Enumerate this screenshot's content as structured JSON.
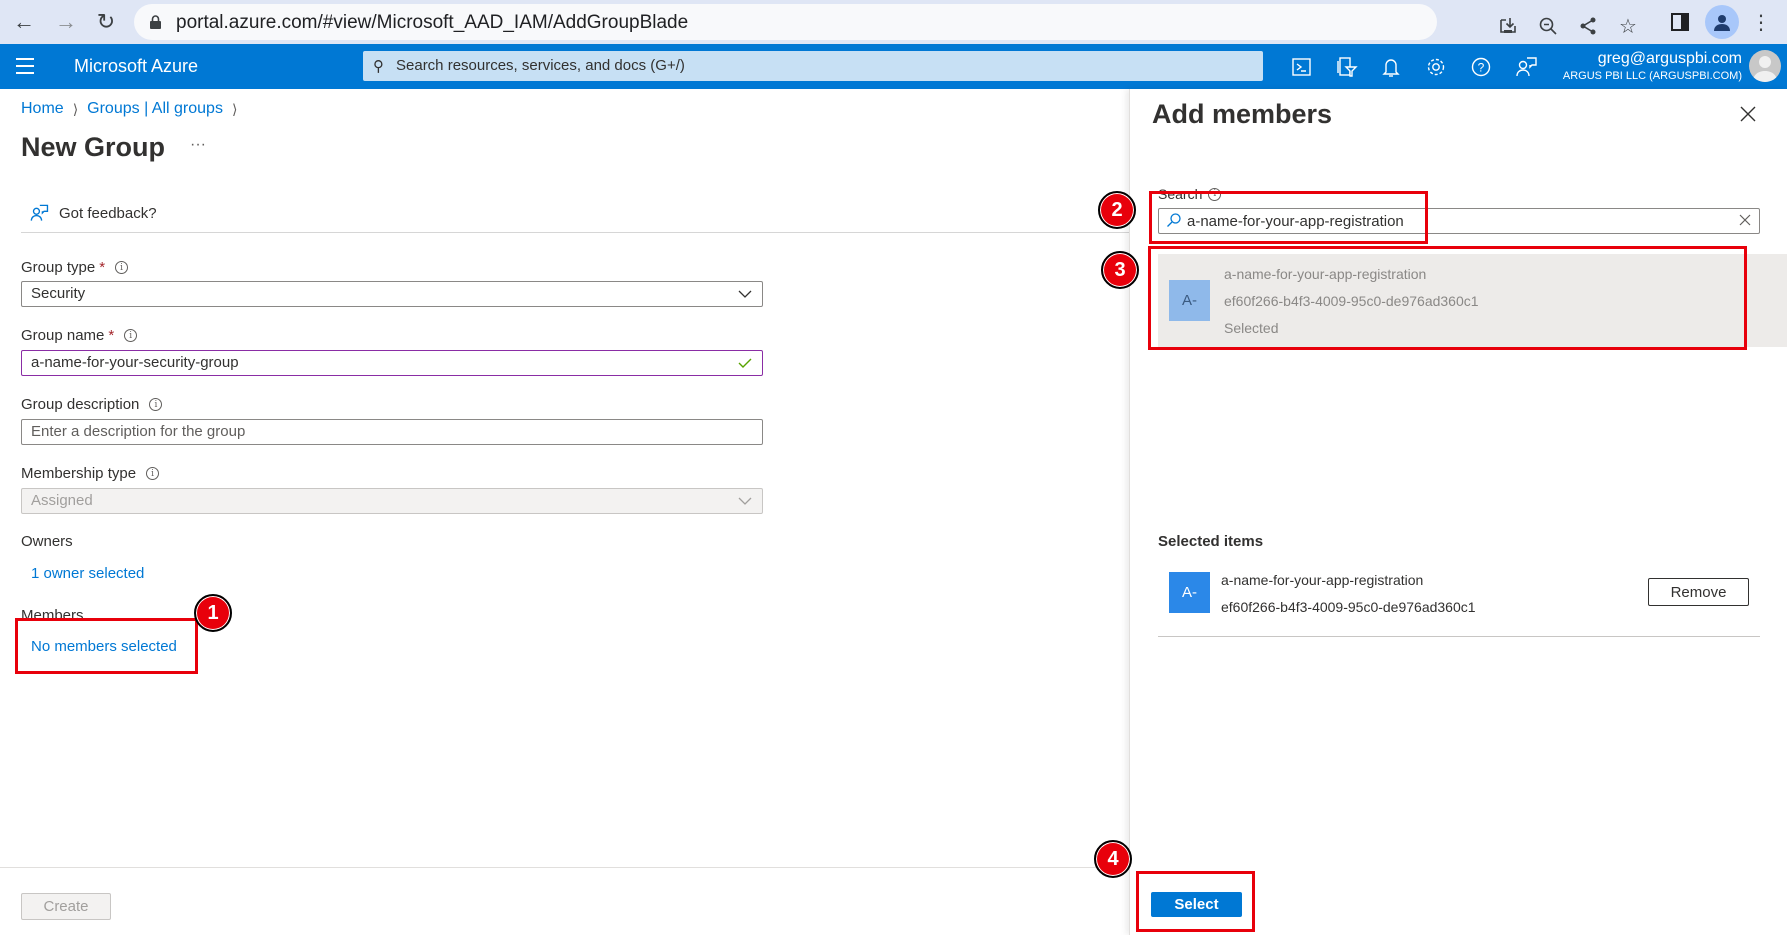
{
  "browser": {
    "url": "portal.azure.com/#view/Microsoft_AAD_IAM/AddGroupBlade",
    "icons": [
      "back-icon",
      "forward-icon",
      "reload-icon",
      "lock-icon",
      "install-icon",
      "zoom-out-icon",
      "share-icon",
      "bookmark-star-icon",
      "side-panel-icon",
      "profile-icon",
      "more-vert-icon"
    ]
  },
  "azure_header": {
    "brand": "Microsoft Azure",
    "search_placeholder": "Search resources, services, and docs (G+/)",
    "icons": [
      "cloud-shell-icon",
      "directory-filter-icon",
      "notifications-icon",
      "settings-icon",
      "help-icon",
      "feedback-icon"
    ],
    "user_email": "greg@arguspbi.com",
    "user_org": "ARGUS PBI LLC (ARGUSPBI.COM)"
  },
  "breadcrumb": [
    {
      "label": "Home"
    },
    {
      "label": "Groups | All groups"
    }
  ],
  "page": {
    "title": "New Group",
    "more_label": "···",
    "feedback_label": "Got feedback?"
  },
  "form": {
    "group_type": {
      "label": "Group type",
      "required": "*",
      "value": "Security"
    },
    "group_name": {
      "label": "Group name",
      "required": "*",
      "value": "a-name-for-your-security-group"
    },
    "group_description": {
      "label": "Group description",
      "placeholder": "Enter a description for the group",
      "value": ""
    },
    "membership_type": {
      "label": "Membership type",
      "value": "Assigned"
    },
    "owners": {
      "label": "Owners",
      "link": "1 owner selected"
    },
    "members": {
      "label": "Members",
      "link": "No members selected"
    }
  },
  "footer": {
    "create_label": "Create",
    "select_label": "Select"
  },
  "blade": {
    "title": "Add members",
    "search_label": "Search",
    "search_value": "a-name-for-your-app-registration",
    "results": [
      {
        "initials": "A-",
        "name": "a-name-for-your-app-registration",
        "id": "ef60f266-b4f3-4009-95c0-de976ad360c1",
        "status": "Selected"
      }
    ],
    "selected_heading": "Selected items",
    "selected_items": [
      {
        "initials": "A-",
        "name": "a-name-for-your-app-registration",
        "id": "ef60f266-b4f3-4009-95c0-de976ad360c1",
        "remove_label": "Remove"
      }
    ]
  },
  "annotations": [
    {
      "number": "1",
      "target": "No members selected"
    },
    {
      "number": "2",
      "target": "Search box"
    },
    {
      "number": "3",
      "target": "Search result"
    },
    {
      "number": "4",
      "target": "Select button"
    }
  ],
  "colors": {
    "azure_blue": "#0078d4",
    "annotation_red": "#e8000b",
    "valid_border": "#8a2da5",
    "valid_check": "#57a300"
  }
}
